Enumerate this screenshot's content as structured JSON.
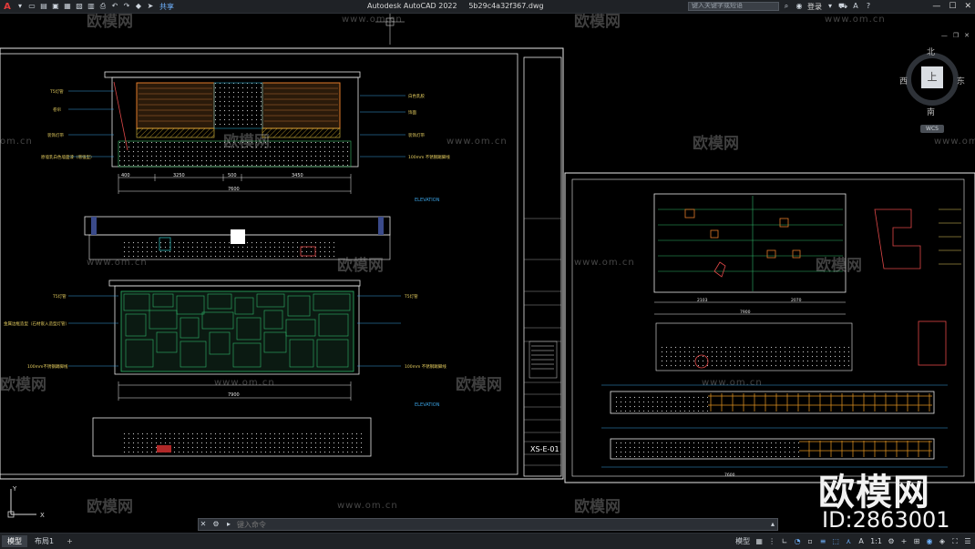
{
  "app": {
    "title": "Autodesk AutoCAD 2022",
    "filename": "5b29c4a32f367.dwg",
    "share_label": "共享",
    "search_placeholder": "键入关键字或短语",
    "login_label": "登录"
  },
  "qat_icons": [
    "new-icon",
    "open-icon",
    "save-icon",
    "saveas-icon",
    "publish-icon",
    "plot-icon",
    "undo-icon",
    "redo-icon",
    "share-icon"
  ],
  "viewcube": {
    "north": "北",
    "south": "南",
    "west": "西",
    "east": "东",
    "face": "上",
    "wcs": "WCS"
  },
  "drawing": {
    "sheet_no": "XS-E-01",
    "elevation_labels": [
      "ELEVATION",
      "ELEVATION"
    ],
    "dims_top": [
      "400",
      "3250",
      "500",
      "3450",
      "7600"
    ],
    "dims_mid": [
      "7900"
    ],
    "right_dims": [
      "2103",
      "2070",
      "7900",
      "7600"
    ],
    "left_notes": [
      "T5灯管",
      "卷帘",
      "装饰灯带",
      "装饰挂画",
      "原墙乳白色墙面漆（增强型）",
      "金属边框造型（石材嵌入造型灯管）",
      "100mm不锈钢踢脚线",
      "100mm 不锈钢踢脚线"
    ],
    "right_notes": [
      "白色乳胶",
      "饰面",
      "装饰灯带",
      "T5灯管",
      "100mm 不锈钢踢脚线"
    ]
  },
  "watermarks": {
    "brand": "欧模网",
    "url": "www.om.cn",
    "domain_fragment": "om.cn",
    "big": "欧模网",
    "id": "ID:2863001"
  },
  "command": {
    "placeholder": "键入命令"
  },
  "status": {
    "tabs": [
      "模型",
      "布局1"
    ],
    "add_tab": "+",
    "mode": "模型",
    "scale": "1:1"
  }
}
